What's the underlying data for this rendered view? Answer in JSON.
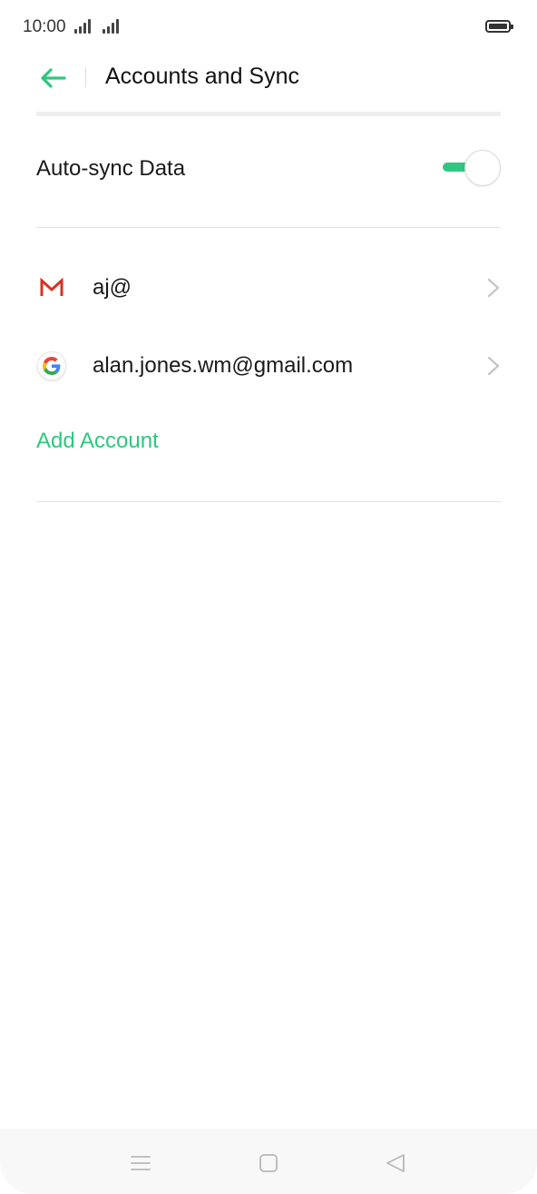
{
  "status_bar": {
    "time": "10:00",
    "icons": [
      "signal-icon",
      "signal-icon",
      "battery-icon"
    ]
  },
  "header": {
    "title": "Accounts and Sync",
    "back_icon": "arrow-left-icon"
  },
  "auto_sync": {
    "label": "Auto-sync Data",
    "enabled": true
  },
  "accounts": [
    {
      "icon": "gmail-icon",
      "label": "aj@"
    },
    {
      "icon": "google-icon",
      "label": "alan.jones.wm@gmail.com"
    }
  ],
  "add_account": {
    "label": "Add Account"
  },
  "nav_bar": {
    "icons": [
      "menu-icon",
      "home-icon",
      "back-triangle-icon"
    ]
  },
  "colors": {
    "accent": "#2dc77f",
    "gmail_red": "#d93025",
    "text": "#1a1a1a",
    "divider": "#e2e2e2"
  }
}
